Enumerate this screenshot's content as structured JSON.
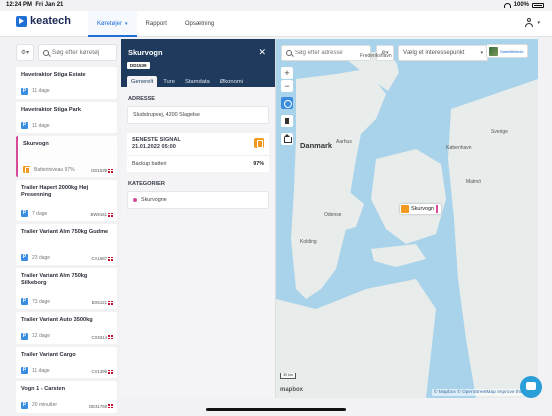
{
  "status": {
    "time": "12:24 PM",
    "date": "Fri Jan 21",
    "battery": "100%"
  },
  "brand": {
    "name": "keatech",
    "accent": "#1f6fd4"
  },
  "nav": {
    "tabs": [
      {
        "label": "Køretøjer"
      },
      {
        "label": "Rapport"
      },
      {
        "label": "Opsætning"
      }
    ]
  },
  "search": {
    "placeholder": "Søg efter køretøj"
  },
  "vehicles": [
    {
      "name": "Havetraktor Stiga Estate",
      "badge": "P",
      "meta": "11 dage",
      "plate": ""
    },
    {
      "name": "Havetraktor Stiga Park",
      "badge": "P",
      "meta": "11 dage",
      "plate": ""
    },
    {
      "name": "Skurvogn",
      "badge": "battery",
      "meta": "Batteriniveau 97%",
      "plate": "DD1539"
    },
    {
      "name": "Trailer Hapert 2000kg Høj Presenning",
      "badge": "P",
      "meta": "7 dage",
      "plate": "BW9161"
    },
    {
      "name": "Trailer Variant Alm 750kg Gudme",
      "badge": "P",
      "meta": "23 dage",
      "plate": "CA1587"
    },
    {
      "name": "Trailer Variant Alm 750kg Silkeborg",
      "badge": "P",
      "meta": "73 dage",
      "plate": "BX5121"
    },
    {
      "name": "Trailer Variant Auto 3500kg",
      "badge": "P",
      "meta": "12 dage",
      "plate": "CX5314"
    },
    {
      "name": "Trailer Variant Cargo",
      "badge": "P",
      "meta": "11 dage",
      "plate": "CV1396"
    },
    {
      "name": "Vogn 1 - Carsten",
      "badge": "P",
      "meta": "20 minutter",
      "plate": "DE31768"
    }
  ],
  "detail": {
    "title": "Skurvogn",
    "plate": "DD1539",
    "tabs": [
      "Generelt",
      "Ture",
      "Stamdata",
      "Økonomi"
    ],
    "address_heading": "ADRESSE",
    "address": "Sludstrupvej, 4200 Slagelse",
    "signal_heading": "SENESTE SIGNAL",
    "signal_time": "21.01.2022 05:00",
    "backup_label": "Backup batteri",
    "backup_value": "97%",
    "categories_heading": "KATEGORIER",
    "category": "Skurvogne",
    "category_color": "#d64a9a"
  },
  "map": {
    "search_placeholder": "Søg efter adresse",
    "poi_placeholder": "Vælg et interessepunkt",
    "satellite_label": "Satellitbillede",
    "country": "Danmark",
    "cities": [
      {
        "name": "Aarhus"
      },
      {
        "name": "Odense"
      },
      {
        "name": "København"
      },
      {
        "name": "Sverige"
      },
      {
        "name": "Kolding"
      },
      {
        "name": "Frederikshavn"
      },
      {
        "name": "Malmö"
      }
    ],
    "marker_label": "Skurvogn",
    "scale": "30 km",
    "attribution": "© Mapbox © OpenStreetMap  Improve this map",
    "logo": "mapbox"
  }
}
